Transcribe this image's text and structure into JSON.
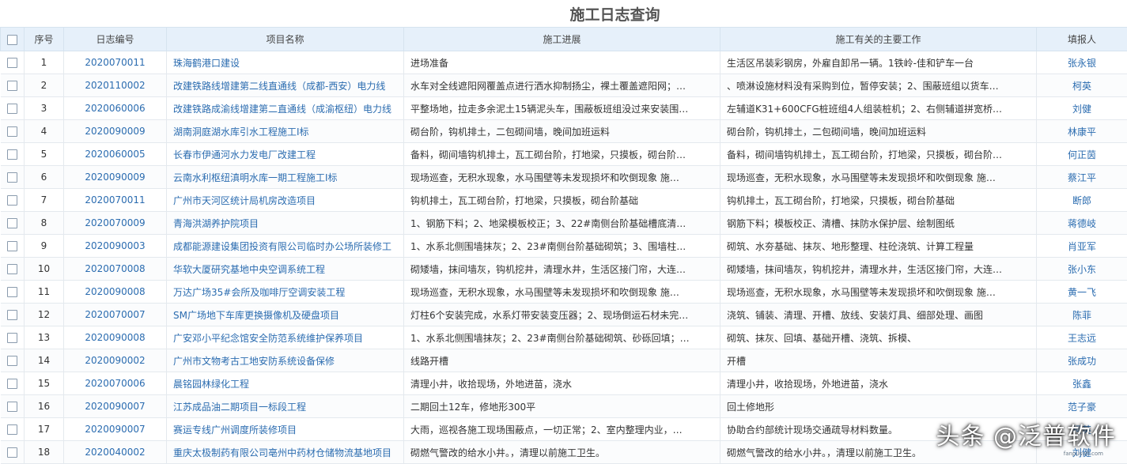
{
  "page": {
    "title": "施工日志查询"
  },
  "columns": {
    "seq": "序号",
    "code": "日志编号",
    "name": "项目名称",
    "progress": "施工进展",
    "work": "施工有关的主要工作",
    "person": "填报人"
  },
  "rows": [
    {
      "seq": "1",
      "code": "2020070011",
      "name": "珠海鹤港口建设",
      "progress": "进场准备",
      "work": "生活区吊装彩钢房，外雇自卸吊一辆。1铁岭-佳和铲车一台",
      "person": "张永银"
    },
    {
      "seq": "2",
      "code": "2020110002",
      "name": "改建铁路线增建第二线直通线（成都-西安）电力线",
      "progress": "水车对全线遮阳网覆盖点进行洒水抑制扬尘，裸土覆盖遮阳网；…",
      "work": "、喷淋设施材料没有采购到位，暂停安装；2、围蔽班组以货车…",
      "person": "柯英"
    },
    {
      "seq": "3",
      "code": "2020060006",
      "name": "改建铁路成渝线增建第二直通线（成渝枢纽）电力线",
      "progress": "平整场地，拉走多余泥土15辆泥头车，围蔽板班组没过来安装围…",
      "work": "左辅道K31+600CFG桩班组4人组装桩机；2、右侧辅道拼宽桥…",
      "person": "刘健"
    },
    {
      "seq": "4",
      "code": "2020090009",
      "name": "湖南洞庭湖水库引水工程施工I标",
      "progress": "砌台阶，钩机排土，二包砌间墙，晚间加班运料",
      "work": "砌台阶，钩机排土，二包砌间墙，晚间加班运料",
      "person": "林康平"
    },
    {
      "seq": "5",
      "code": "2020060005",
      "name": "长春市伊通河水力发电厂改建工程",
      "progress": "备料，砌间墙钩机排土，瓦工砌台阶，打地梁，只摸板，砌台阶…",
      "work": "备料，砌间墙钩机排土，瓦工砌台阶，打地梁，只摸板，砌台阶…",
      "person": "何正茵"
    },
    {
      "seq": "6",
      "code": "2020090009",
      "name": "云南水利枢纽滇明水库一期工程施工I标",
      "progress": "现场巡查，无积水现象，水马围壁等未发现损坏和吹倒现象 施…",
      "work": "现场巡查，无积水现象，水马围壁等未发现损坏和吹倒现象 施…",
      "person": "蔡江平"
    },
    {
      "seq": "7",
      "code": "2020070011",
      "name": "广州市天河区统计局机房改造项目",
      "progress": "钩机排土，瓦工砌台阶，打地梁，只摸板，砌台阶基础",
      "work": "钩机排土，瓦工砌台阶，打地梁，只摸板，砌台阶基础",
      "person": "断郎"
    },
    {
      "seq": "8",
      "code": "2020070009",
      "name": "青海洪湖养护院项目",
      "progress": "1、钢筋下料；2、地梁模板校正；3、22#南侧台阶基础槽底清…",
      "work": "钢筋下料；模板校正、清槽、抹防水保护层、绘制图纸",
      "person": "蒋德岐"
    },
    {
      "seq": "9",
      "code": "2020090003",
      "name": "成都能源建设集团投资有限公司临时办公场所装修工",
      "progress": "1、水系北侧围墙抹灰；2、23#南侧台阶基础砌筑；3、围墙柱…",
      "work": "砌筑、水夯基础、抹灰、地形整理、柱砼浇筑、计算工程量",
      "person": "肖亚军"
    },
    {
      "seq": "10",
      "code": "2020070008",
      "name": "华软大厦研究基地中央空调系统工程",
      "progress": "砌矮墙，抹间墙灰，钩机挖井，清理水井，生活区接门帘，大连…",
      "work": "砌矮墙，抹间墙灰，钩机挖井，清理水井，生活区接门帘，大连…",
      "person": "张小东"
    },
    {
      "seq": "11",
      "code": "2020090008",
      "name": "万达广场35#会所及咖啡厅空调安装工程",
      "progress": "现场巡查，无积水现象，水马围壁等未发现损坏和吹倒现象 施…",
      "work": "现场巡查，无积水现象，水马围壁等未发现损坏和吹倒现象 施…",
      "person": "黄一飞"
    },
    {
      "seq": "12",
      "code": "2020070007",
      "name": "SM广场地下车库更换摄像机及硬盘项目",
      "progress": "灯柱6个安装完成，水系灯带安装变压器；2、现场倒运石材未完…",
      "work": "浇筑、铺装、清理、开槽、放线、安装灯具、细部处理、画图",
      "person": "陈菲"
    },
    {
      "seq": "13",
      "code": "2020090008",
      "name": "广安邓小平纪念馆安全防范系统维护保养项目",
      "progress": "1、水系北侧围墙抹灰；2、23#南侧台阶基础砌筑、砂砾回填；…",
      "work": "砌筑、抹灰、回填、基础开槽、浇筑、拆模、",
      "person": "王志远"
    },
    {
      "seq": "14",
      "code": "2020090002",
      "name": "广州市文物考古工地安防系统设备保修",
      "progress": "线路开槽",
      "work": "开槽",
      "person": "张成功"
    },
    {
      "seq": "15",
      "code": "2020070006",
      "name": "晨铭园林绿化工程",
      "progress": "清理小井，收拾现场，外地进苗，浇水",
      "work": "清理小井，收拾现场，外地进苗，浇水",
      "person": "张鑫"
    },
    {
      "seq": "16",
      "code": "2020090007",
      "name": "江苏成品油二期项目一标段工程",
      "progress": "二期回土12车，修地形300平",
      "work": "回土修地形",
      "person": "范子豪"
    },
    {
      "seq": "17",
      "code": "2020090007",
      "name": "赛运专线广州调度所装修项目",
      "progress": "大雨，巡视各施工现场围蔽点，一切正常；2、室内整理内业，…",
      "work": "协助合约部统计现场交通疏导材料数量。",
      "person": "柯英"
    },
    {
      "seq": "18",
      "code": "2020040002",
      "name": "重庆太极制药有限公司亳州中药材仓储物流基地项目",
      "progress": "砌燃气警改的给水小井。，清理以前施工卫生。",
      "work": "砌燃气警改的给水小井。，清理以前施工卫生。",
      "person": "刘健"
    }
  ],
  "watermark": {
    "text": "头条 @泛普软件",
    "sub": "fanpusoft.com"
  }
}
